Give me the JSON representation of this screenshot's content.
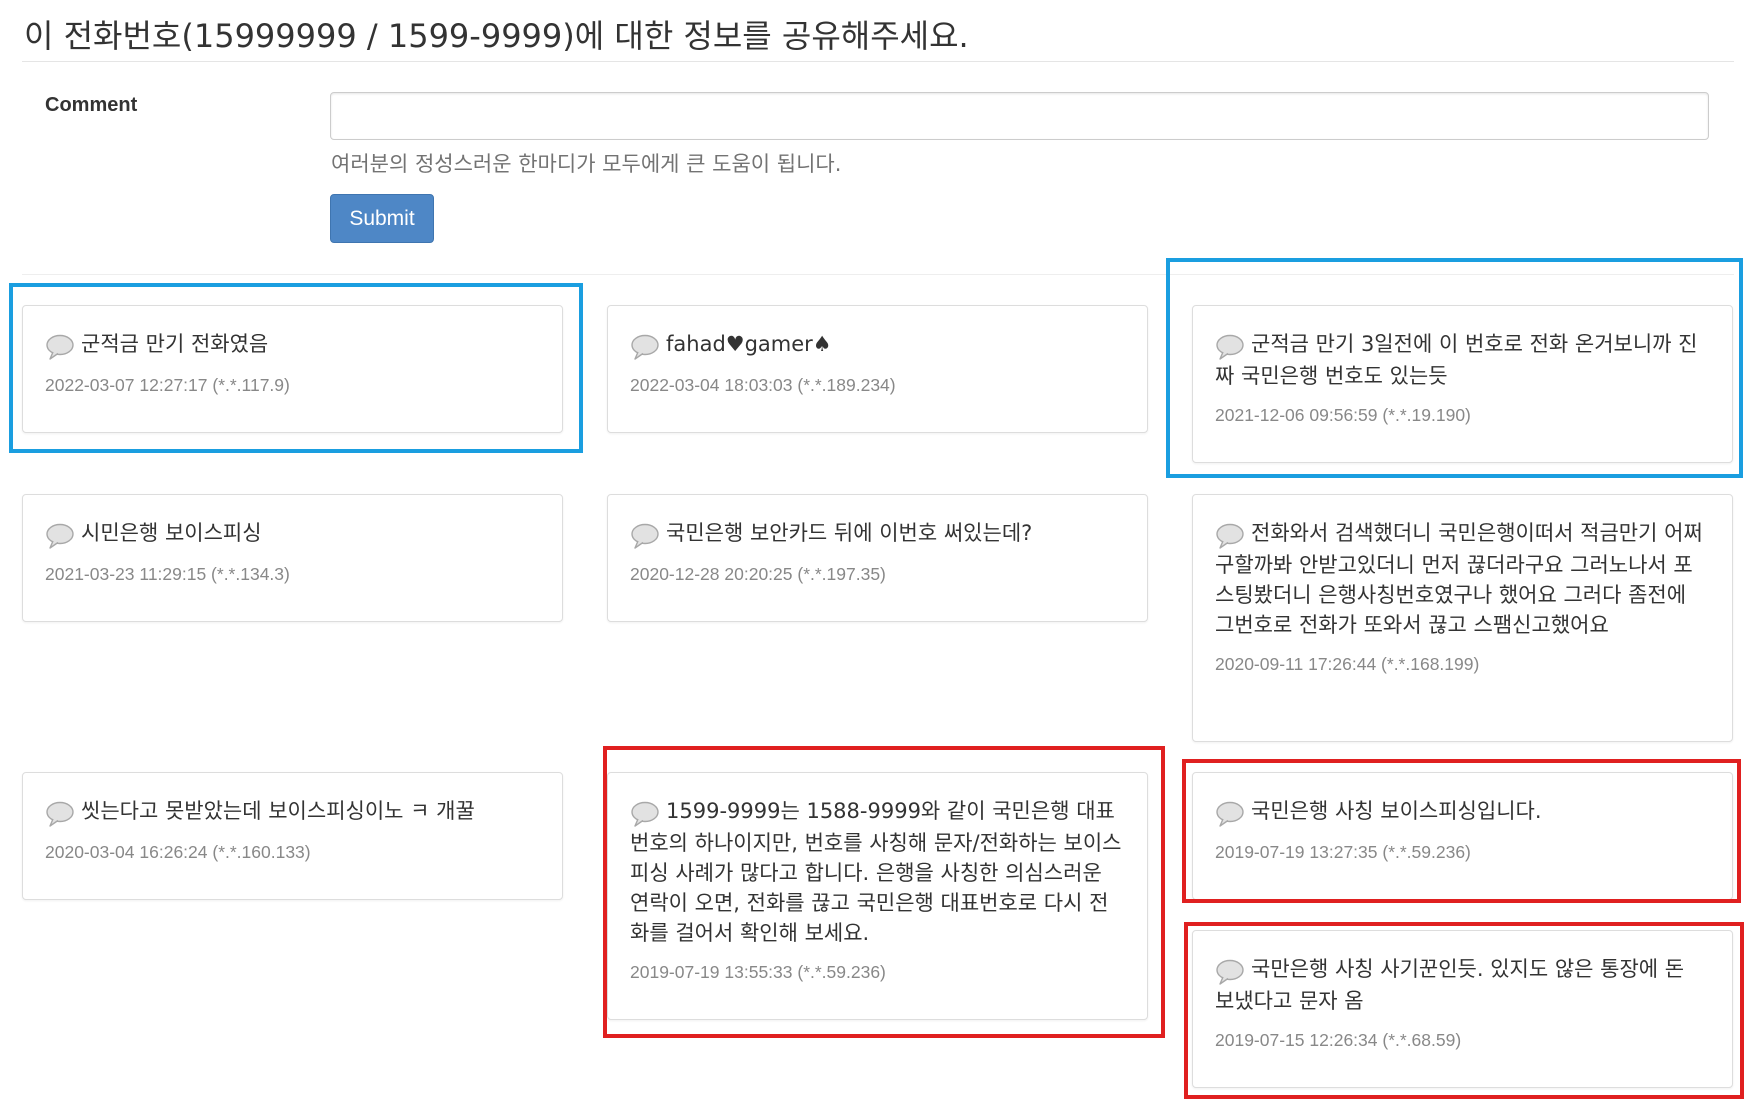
{
  "page": {
    "title": "이 전화번호(15999999 / 1599-9999)에 대한 정보를 공유해주세요."
  },
  "form": {
    "comment_label": "Comment",
    "comment_value": "",
    "help_text": "여러분의 정성스러운 한마디가 모두에게 큰 도움이 됩니다.",
    "submit_label": "Submit"
  },
  "highlight_colors": {
    "blue": "#1a9ee0",
    "red": "#e02020"
  },
  "comments": [
    {
      "text": "군적금 만기 전화였음",
      "meta": "2022-03-07 12:27:17 (*.*.117.9)",
      "highlight": "blue"
    },
    {
      "text": "fahad♥gamer♠",
      "meta": "2022-03-04 18:03:03 (*.*.189.234)",
      "highlight": ""
    },
    {
      "text": "군적금 만기 3일전에 이 번호로 전화 온거보니까 진짜 국민은행 번호도 있는듯",
      "meta": "2021-12-06 09:56:59 (*.*.19.190)",
      "highlight": "blue"
    },
    {
      "text": "시민은행 보이스피싱",
      "meta": "2021-03-23 11:29:15 (*.*.134.3)",
      "highlight": ""
    },
    {
      "text": "국민은행 보안카드 뒤에 이번호 써있는데?",
      "meta": "2020-12-28 20:20:25 (*.*.197.35)",
      "highlight": ""
    },
    {
      "text": "전화와서 검색했더니 국민은행이떠서 적금만기 어쩌구할까봐 안받고있더니 먼저 끊더라구요 그러노나서 포스팅봤더니 은행사칭번호였구나 했어요 그러다 좀전에 그번호로 전화가 또와서 끊고 스팸신고했어요",
      "meta": "2020-09-11 17:26:44 (*.*.168.199)",
      "highlight": ""
    },
    {
      "text": "씻는다고 못받았는데 보이스피싱이노 ㅋ 개꿀",
      "meta": "2020-03-04 16:26:24 (*.*.160.133)",
      "highlight": ""
    },
    {
      "text": "1599-9999는 1588-9999와 같이 국민은행 대표번호의 하나이지만, 번호를 사칭해 문자/전화하는 보이스 피싱 사례가 많다고 합니다. 은행을 사칭한 의심스러운 연락이 오면, 전화를 끊고 국민은행 대표번호로 다시 전화를 걸어서 확인해 보세요.",
      "meta": "2019-07-19 13:55:33 (*.*.59.236)",
      "highlight": "red"
    },
    {
      "text": "국민은행 사칭 보이스피싱입니다.",
      "meta": "2019-07-19 13:27:35 (*.*.59.236)",
      "highlight": "red"
    },
    {
      "text": "국만은행 사칭 사기꾼인듯. 있지도 않은 통장에 돈 보냈다고 문자 옴",
      "meta": "2019-07-15 12:26:34 (*.*.68.59)",
      "highlight": "red"
    }
  ]
}
